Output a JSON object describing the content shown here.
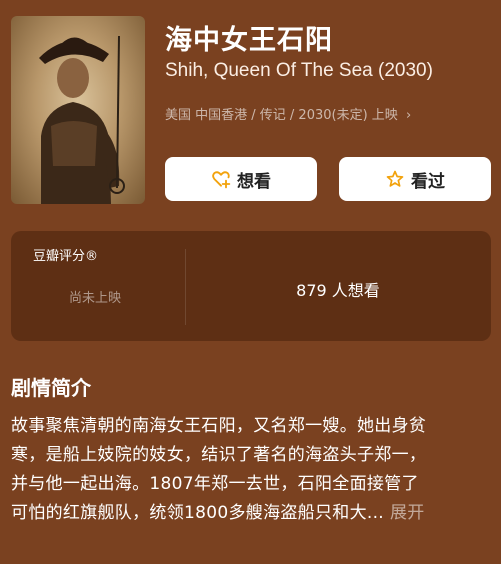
{
  "movie": {
    "title": "海中女王石阳",
    "original_title": "Shih, Queen Of The Sea (2030)",
    "meta": "美国 中国香港 / 传记 / 2030(未定) 上映",
    "meta_chevron": "›"
  },
  "actions": {
    "want_label": "想看",
    "seen_label": "看过"
  },
  "rating": {
    "label": "豆瓣评分®",
    "status": "尚未上映",
    "want_count": "879 人想看"
  },
  "synopsis": {
    "heading": "剧情简介",
    "lines": [
      "故事聚焦清朝的南海女王石阳，又名郑一嫂。她出身贫",
      "寒，是船上妓院的妓女，结识了著名的海盗头子郑一，",
      "并与他一起出海。1807年郑一去世，石阳全面接管了",
      "可怕的红旗舰队，统领1800多艘海盗船只和大..."
    ],
    "expand_label": "展开"
  },
  "colors": {
    "background": "#7a4120",
    "card": "#5e2f14",
    "accent": "#f2a20c"
  },
  "icons": {
    "want": "heart-plus-icon",
    "seen": "star-outline-icon"
  }
}
